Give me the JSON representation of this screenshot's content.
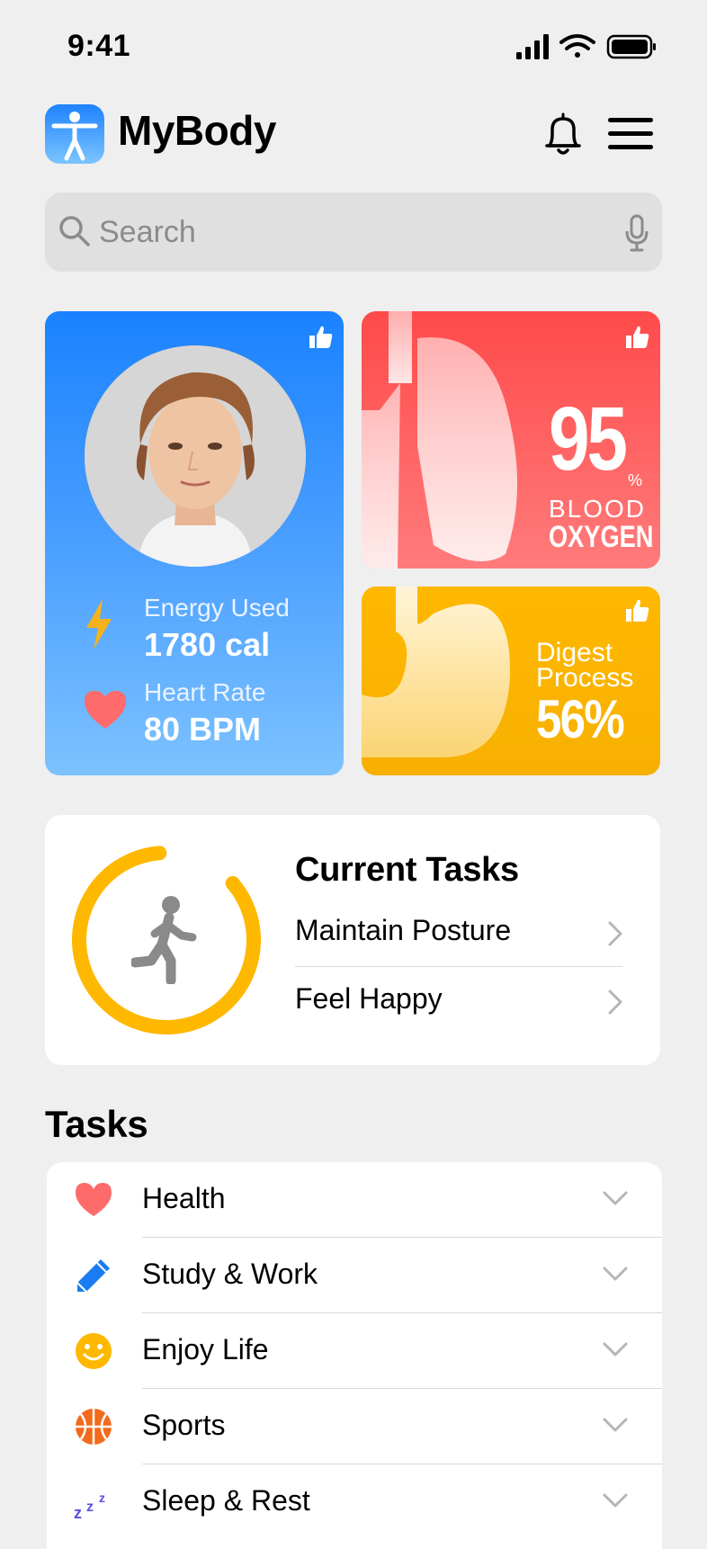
{
  "status_bar": {
    "time": "9:41"
  },
  "header": {
    "app_title": "MyBody"
  },
  "search": {
    "placeholder": "Search"
  },
  "profile_card": {
    "energy_label": "Energy Used",
    "energy_value": "1780 cal",
    "heart_label": "Heart Rate",
    "heart_value": "80 BPM"
  },
  "oxygen_card": {
    "value": "95",
    "unit": "%",
    "line1": "BLOOD",
    "line2": "OXYGEN"
  },
  "digest_card": {
    "line1": "Digest",
    "line2": "Process",
    "value": "56%"
  },
  "current_tasks": {
    "title": "Current Tasks",
    "progress": 0.85,
    "items": [
      {
        "label": "Maintain Posture"
      },
      {
        "label": "Feel Happy"
      }
    ]
  },
  "tasks": {
    "heading": "Tasks",
    "items": [
      {
        "label": "Health",
        "icon": "heart-icon"
      },
      {
        "label": "Study & Work",
        "icon": "pencil-icon"
      },
      {
        "label": "Enjoy Life",
        "icon": "smiley-icon"
      },
      {
        "label": "Sports",
        "icon": "basketball-icon"
      },
      {
        "label": "Sleep & Rest",
        "icon": "zzz-icon"
      }
    ]
  },
  "colors": {
    "profile_blue": "#1a82ff",
    "oxygen_red": "#ff4a4a",
    "digest_yellow": "#ffb800",
    "ring_yellow": "#ffb800",
    "heart_red": "#ff6b6b"
  }
}
